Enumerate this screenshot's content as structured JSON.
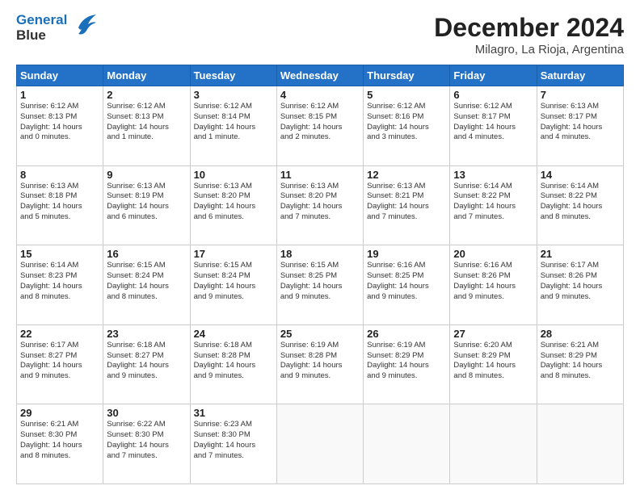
{
  "header": {
    "logo_line1": "General",
    "logo_line2": "Blue",
    "month": "December 2024",
    "location": "Milagro, La Rioja, Argentina"
  },
  "days_of_week": [
    "Sunday",
    "Monday",
    "Tuesday",
    "Wednesday",
    "Thursday",
    "Friday",
    "Saturday"
  ],
  "weeks": [
    [
      {
        "day": "1",
        "info": "Sunrise: 6:12 AM\nSunset: 8:13 PM\nDaylight: 14 hours\nand 0 minutes."
      },
      {
        "day": "2",
        "info": "Sunrise: 6:12 AM\nSunset: 8:13 PM\nDaylight: 14 hours\nand 1 minute."
      },
      {
        "day": "3",
        "info": "Sunrise: 6:12 AM\nSunset: 8:14 PM\nDaylight: 14 hours\nand 1 minute."
      },
      {
        "day": "4",
        "info": "Sunrise: 6:12 AM\nSunset: 8:15 PM\nDaylight: 14 hours\nand 2 minutes."
      },
      {
        "day": "5",
        "info": "Sunrise: 6:12 AM\nSunset: 8:16 PM\nDaylight: 14 hours\nand 3 minutes."
      },
      {
        "day": "6",
        "info": "Sunrise: 6:12 AM\nSunset: 8:17 PM\nDaylight: 14 hours\nand 4 minutes."
      },
      {
        "day": "7",
        "info": "Sunrise: 6:13 AM\nSunset: 8:17 PM\nDaylight: 14 hours\nand 4 minutes."
      }
    ],
    [
      {
        "day": "8",
        "info": "Sunrise: 6:13 AM\nSunset: 8:18 PM\nDaylight: 14 hours\nand 5 minutes."
      },
      {
        "day": "9",
        "info": "Sunrise: 6:13 AM\nSunset: 8:19 PM\nDaylight: 14 hours\nand 6 minutes."
      },
      {
        "day": "10",
        "info": "Sunrise: 6:13 AM\nSunset: 8:20 PM\nDaylight: 14 hours\nand 6 minutes."
      },
      {
        "day": "11",
        "info": "Sunrise: 6:13 AM\nSunset: 8:20 PM\nDaylight: 14 hours\nand 7 minutes."
      },
      {
        "day": "12",
        "info": "Sunrise: 6:13 AM\nSunset: 8:21 PM\nDaylight: 14 hours\nand 7 minutes."
      },
      {
        "day": "13",
        "info": "Sunrise: 6:14 AM\nSunset: 8:22 PM\nDaylight: 14 hours\nand 7 minutes."
      },
      {
        "day": "14",
        "info": "Sunrise: 6:14 AM\nSunset: 8:22 PM\nDaylight: 14 hours\nand 8 minutes."
      }
    ],
    [
      {
        "day": "15",
        "info": "Sunrise: 6:14 AM\nSunset: 8:23 PM\nDaylight: 14 hours\nand 8 minutes."
      },
      {
        "day": "16",
        "info": "Sunrise: 6:15 AM\nSunset: 8:24 PM\nDaylight: 14 hours\nand 8 minutes."
      },
      {
        "day": "17",
        "info": "Sunrise: 6:15 AM\nSunset: 8:24 PM\nDaylight: 14 hours\nand 9 minutes."
      },
      {
        "day": "18",
        "info": "Sunrise: 6:15 AM\nSunset: 8:25 PM\nDaylight: 14 hours\nand 9 minutes."
      },
      {
        "day": "19",
        "info": "Sunrise: 6:16 AM\nSunset: 8:25 PM\nDaylight: 14 hours\nand 9 minutes."
      },
      {
        "day": "20",
        "info": "Sunrise: 6:16 AM\nSunset: 8:26 PM\nDaylight: 14 hours\nand 9 minutes."
      },
      {
        "day": "21",
        "info": "Sunrise: 6:17 AM\nSunset: 8:26 PM\nDaylight: 14 hours\nand 9 minutes."
      }
    ],
    [
      {
        "day": "22",
        "info": "Sunrise: 6:17 AM\nSunset: 8:27 PM\nDaylight: 14 hours\nand 9 minutes."
      },
      {
        "day": "23",
        "info": "Sunrise: 6:18 AM\nSunset: 8:27 PM\nDaylight: 14 hours\nand 9 minutes."
      },
      {
        "day": "24",
        "info": "Sunrise: 6:18 AM\nSunset: 8:28 PM\nDaylight: 14 hours\nand 9 minutes."
      },
      {
        "day": "25",
        "info": "Sunrise: 6:19 AM\nSunset: 8:28 PM\nDaylight: 14 hours\nand 9 minutes."
      },
      {
        "day": "26",
        "info": "Sunrise: 6:19 AM\nSunset: 8:29 PM\nDaylight: 14 hours\nand 9 minutes."
      },
      {
        "day": "27",
        "info": "Sunrise: 6:20 AM\nSunset: 8:29 PM\nDaylight: 14 hours\nand 8 minutes."
      },
      {
        "day": "28",
        "info": "Sunrise: 6:21 AM\nSunset: 8:29 PM\nDaylight: 14 hours\nand 8 minutes."
      }
    ],
    [
      {
        "day": "29",
        "info": "Sunrise: 6:21 AM\nSunset: 8:30 PM\nDaylight: 14 hours\nand 8 minutes."
      },
      {
        "day": "30",
        "info": "Sunrise: 6:22 AM\nSunset: 8:30 PM\nDaylight: 14 hours\nand 7 minutes."
      },
      {
        "day": "31",
        "info": "Sunrise: 6:23 AM\nSunset: 8:30 PM\nDaylight: 14 hours\nand 7 minutes."
      },
      null,
      null,
      null,
      null
    ]
  ]
}
